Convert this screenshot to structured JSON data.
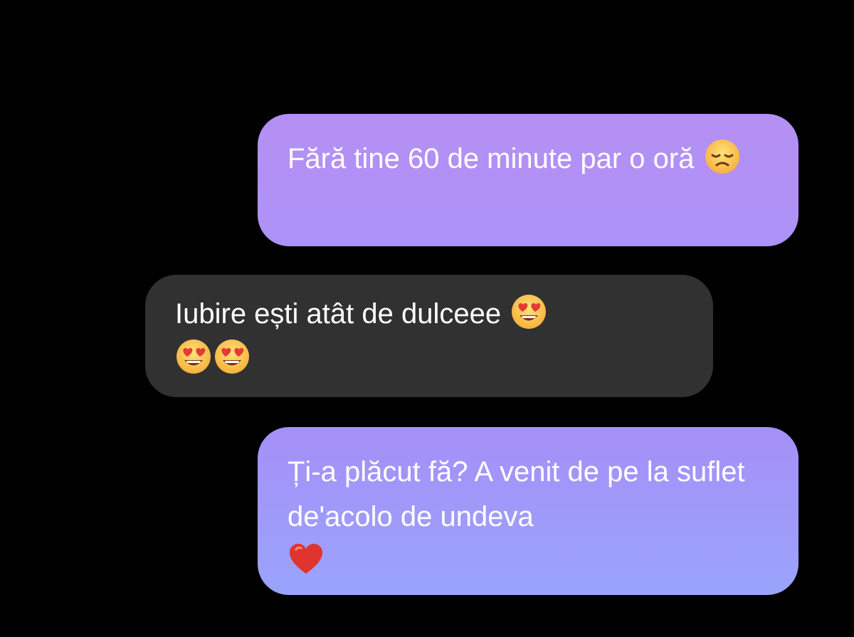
{
  "messages": [
    {
      "direction": "outgoing",
      "text": "Fără tine 60 de minute par o oră",
      "emojis": [
        "disappointed-face"
      ],
      "bubble_color": "#b18ff5"
    },
    {
      "direction": "incoming",
      "text": "Iubire ești atât de dulceee",
      "emojis": [
        "heart-eyes-face",
        "heart-eyes-face",
        "heart-eyes-face"
      ],
      "bubble_color": "#313131"
    },
    {
      "direction": "outgoing",
      "text": "Ți-a plăcut fă? A venit de pe la suflet de'acolo de undeva",
      "emojis": [
        "red-heart"
      ],
      "bubble_color": "#9f9af9"
    }
  ],
  "theme": {
    "background": "#000000",
    "text_color": "#ffffff"
  }
}
